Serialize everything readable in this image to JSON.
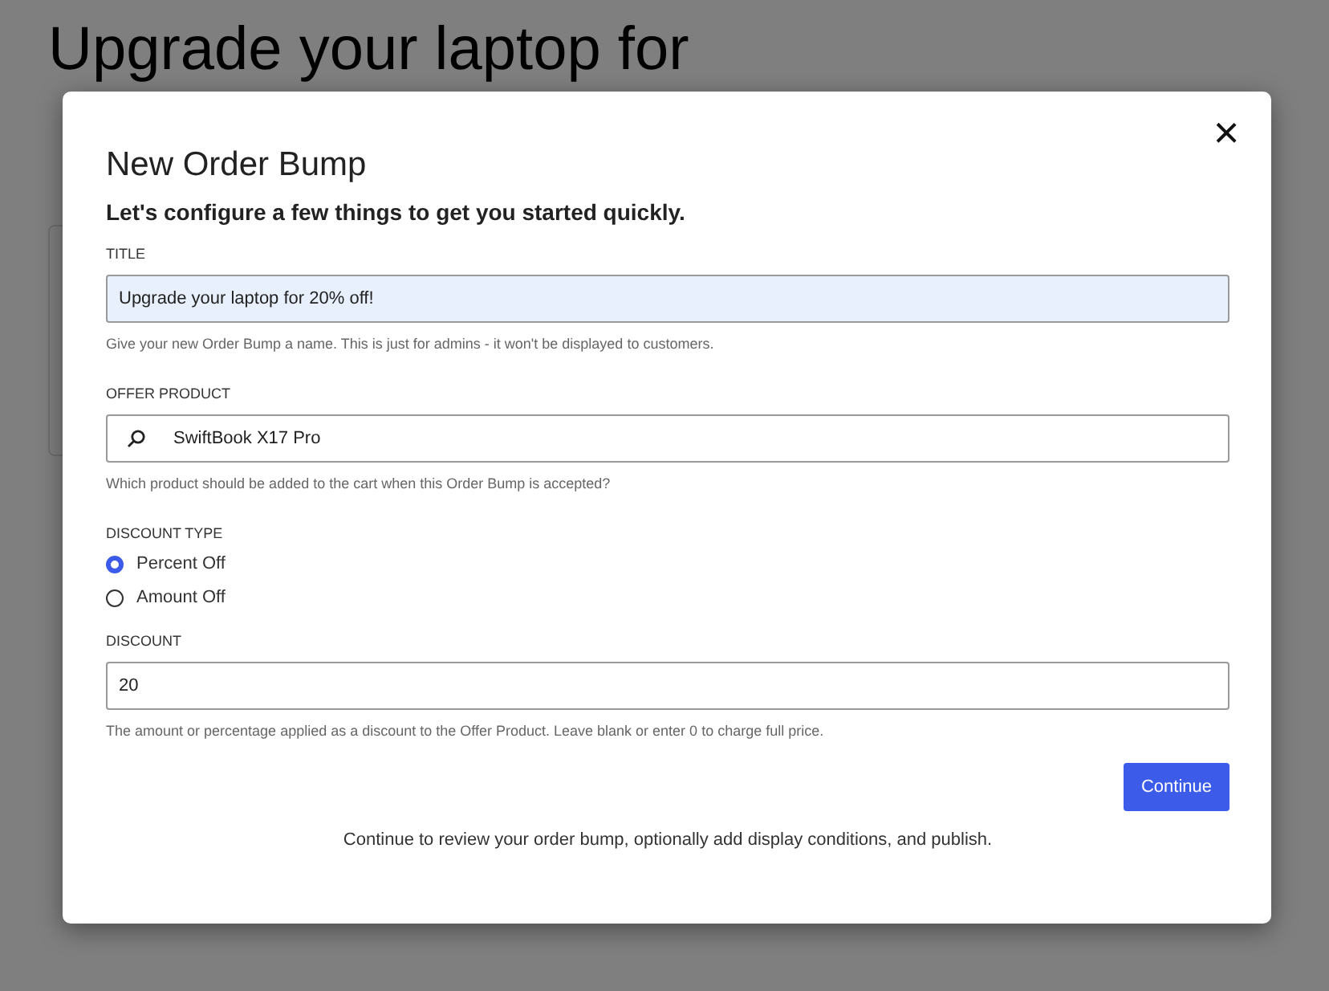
{
  "background": {
    "heading_lines": [
      "Upgrade your laptop for"
    ]
  },
  "dialog": {
    "title": "New Order Bump",
    "subtitle": "Let's configure a few things to get you started quickly.",
    "close": "×",
    "title_field": {
      "label": "TITLE",
      "value": "Upgrade your laptop for 20% off!",
      "help": "Give your new Order Bump a name. This is just for admins - it won't be displayed to customers."
    },
    "offer_product": {
      "label": "OFFER PRODUCT",
      "value": "SwiftBook X17 Pro",
      "help": "Which product should be added to the cart when this Order Bump is accepted?"
    },
    "discount_type": {
      "label": "DISCOUNT TYPE",
      "options": [
        {
          "label": "Percent Off",
          "selected": true
        },
        {
          "label": "Amount Off",
          "selected": false
        }
      ]
    },
    "discount": {
      "label": "DISCOUNT",
      "value": "20",
      "help": "The amount or percentage applied as a discount to the Offer Product. Leave blank or enter 0 to charge full price."
    },
    "continue_button": "Continue",
    "footer_note": "Continue to review your order bump, optionally add display conditions, and publish."
  }
}
